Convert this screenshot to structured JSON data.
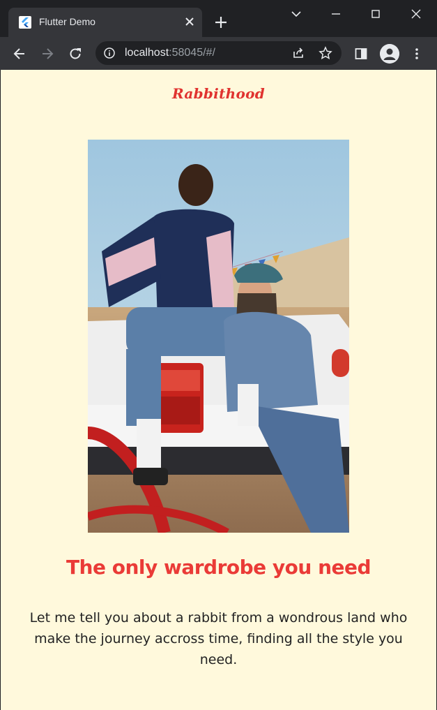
{
  "browser": {
    "tab": {
      "title": "Flutter Demo"
    },
    "omnibox": {
      "host": "localhost",
      "rest": ":58045/#/"
    }
  },
  "page": {
    "brand": "Rabbithood",
    "headline": "The only wardrobe you need",
    "body": "Let me tell you about a rabbit from a wondrous land who make the journey accross time, finding all the style you need."
  },
  "colors": {
    "page_background": "#fff9dc",
    "brand_red": "#e0332f",
    "headline_red": "#ea3b37"
  }
}
